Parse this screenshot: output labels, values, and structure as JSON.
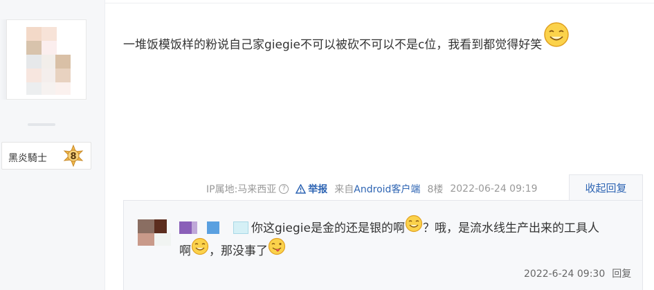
{
  "post": {
    "content": "一堆饭模饭样的粉说自己家giegie不可以被砍不可以不是c位，我看到都觉得好笑",
    "ip_location": "IP属地:马来西亚",
    "report_label": "举报",
    "client_prefix": "来自",
    "client_name": "Android客户端",
    "floor": "8楼",
    "datetime": "2022-06-24 09:19",
    "collapse_label": "收起回复"
  },
  "author": {
    "level_title": "黑炎騎士",
    "level_number": "8"
  },
  "reply": {
    "text_part1": "你这giegie是金的还是银的啊",
    "text_part2": "？哦，是流水线生产出来的工具人",
    "text_part3": "啊",
    "text_part4": "，那没事了",
    "datetime": "2022-6-24 09:30",
    "reply_label": "回复"
  },
  "colors": {
    "link": "#2d64b3",
    "muted": "#999999",
    "sidebar_bg": "#f6f7f9",
    "reply_bg": "#f7f8fa"
  }
}
